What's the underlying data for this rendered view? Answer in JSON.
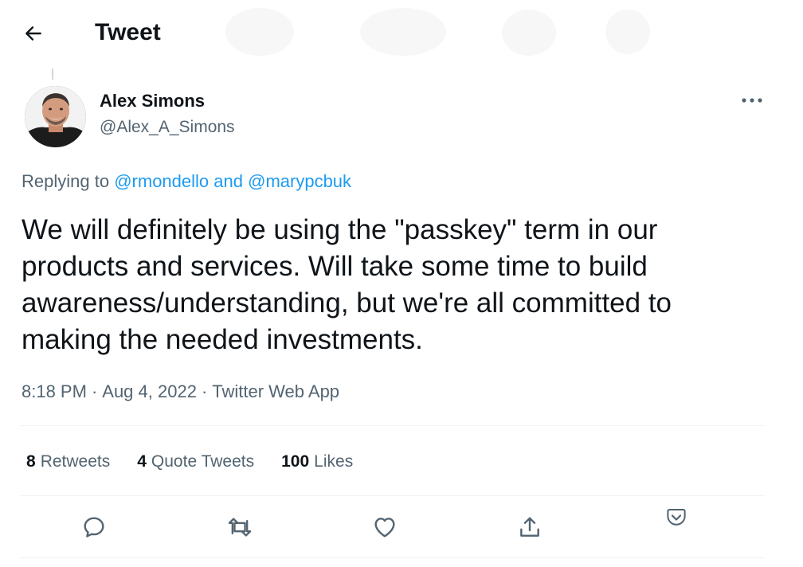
{
  "header": {
    "title": "Tweet",
    "back_icon": "arrow-left-icon"
  },
  "author": {
    "name": "Alex Simons",
    "handle": "@Alex_A_Simons"
  },
  "replying": {
    "prefix": "Replying to",
    "user1": "@rmondello",
    "conj": "and",
    "user2": "@marypcbuk"
  },
  "tweet": {
    "text": "We will definitely be using the \"passkey\" term in our products and services. Will take some time to build awareness/understanding, but we're all committed to making the needed investments."
  },
  "meta": {
    "time": "8:18 PM",
    "sep": "·",
    "date": "Aug 4, 2022",
    "source": "Twitter Web App"
  },
  "stats": [
    {
      "count": "8",
      "label": "Retweets"
    },
    {
      "count": "4",
      "label": "Quote Tweets"
    },
    {
      "count": "100",
      "label": "Likes"
    }
  ],
  "actions": [
    "reply-icon",
    "retweet-icon",
    "like-icon",
    "share-icon",
    "save-icon"
  ],
  "colors": {
    "link": "#1d9bf0",
    "secondary": "#536471",
    "text": "#0f1419",
    "divider": "#eff3f4"
  }
}
